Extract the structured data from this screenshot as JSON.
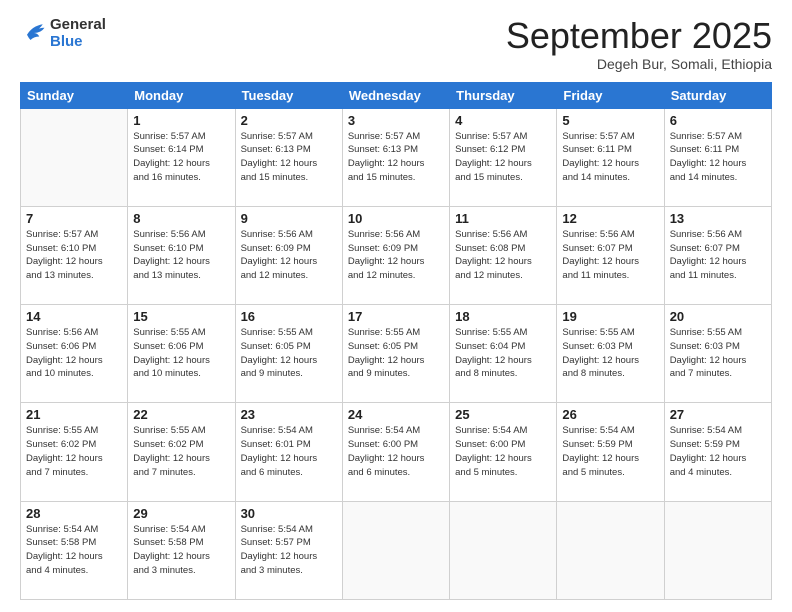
{
  "logo": {
    "line1": "General",
    "line2": "Blue"
  },
  "title": "September 2025",
  "subtitle": "Degeh Bur, Somali, Ethiopia",
  "days": [
    "Sunday",
    "Monday",
    "Tuesday",
    "Wednesday",
    "Thursday",
    "Friday",
    "Saturday"
  ],
  "weeks": [
    [
      {
        "num": "",
        "info": ""
      },
      {
        "num": "1",
        "info": "Sunrise: 5:57 AM\nSunset: 6:14 PM\nDaylight: 12 hours\nand 16 minutes."
      },
      {
        "num": "2",
        "info": "Sunrise: 5:57 AM\nSunset: 6:13 PM\nDaylight: 12 hours\nand 15 minutes."
      },
      {
        "num": "3",
        "info": "Sunrise: 5:57 AM\nSunset: 6:13 PM\nDaylight: 12 hours\nand 15 minutes."
      },
      {
        "num": "4",
        "info": "Sunrise: 5:57 AM\nSunset: 6:12 PM\nDaylight: 12 hours\nand 15 minutes."
      },
      {
        "num": "5",
        "info": "Sunrise: 5:57 AM\nSunset: 6:11 PM\nDaylight: 12 hours\nand 14 minutes."
      },
      {
        "num": "6",
        "info": "Sunrise: 5:57 AM\nSunset: 6:11 PM\nDaylight: 12 hours\nand 14 minutes."
      }
    ],
    [
      {
        "num": "7",
        "info": "Sunrise: 5:57 AM\nSunset: 6:10 PM\nDaylight: 12 hours\nand 13 minutes."
      },
      {
        "num": "8",
        "info": "Sunrise: 5:56 AM\nSunset: 6:10 PM\nDaylight: 12 hours\nand 13 minutes."
      },
      {
        "num": "9",
        "info": "Sunrise: 5:56 AM\nSunset: 6:09 PM\nDaylight: 12 hours\nand 12 minutes."
      },
      {
        "num": "10",
        "info": "Sunrise: 5:56 AM\nSunset: 6:09 PM\nDaylight: 12 hours\nand 12 minutes."
      },
      {
        "num": "11",
        "info": "Sunrise: 5:56 AM\nSunset: 6:08 PM\nDaylight: 12 hours\nand 12 minutes."
      },
      {
        "num": "12",
        "info": "Sunrise: 5:56 AM\nSunset: 6:07 PM\nDaylight: 12 hours\nand 11 minutes."
      },
      {
        "num": "13",
        "info": "Sunrise: 5:56 AM\nSunset: 6:07 PM\nDaylight: 12 hours\nand 11 minutes."
      }
    ],
    [
      {
        "num": "14",
        "info": "Sunrise: 5:56 AM\nSunset: 6:06 PM\nDaylight: 12 hours\nand 10 minutes."
      },
      {
        "num": "15",
        "info": "Sunrise: 5:55 AM\nSunset: 6:06 PM\nDaylight: 12 hours\nand 10 minutes."
      },
      {
        "num": "16",
        "info": "Sunrise: 5:55 AM\nSunset: 6:05 PM\nDaylight: 12 hours\nand 9 minutes."
      },
      {
        "num": "17",
        "info": "Sunrise: 5:55 AM\nSunset: 6:05 PM\nDaylight: 12 hours\nand 9 minutes."
      },
      {
        "num": "18",
        "info": "Sunrise: 5:55 AM\nSunset: 6:04 PM\nDaylight: 12 hours\nand 8 minutes."
      },
      {
        "num": "19",
        "info": "Sunrise: 5:55 AM\nSunset: 6:03 PM\nDaylight: 12 hours\nand 8 minutes."
      },
      {
        "num": "20",
        "info": "Sunrise: 5:55 AM\nSunset: 6:03 PM\nDaylight: 12 hours\nand 7 minutes."
      }
    ],
    [
      {
        "num": "21",
        "info": "Sunrise: 5:55 AM\nSunset: 6:02 PM\nDaylight: 12 hours\nand 7 minutes."
      },
      {
        "num": "22",
        "info": "Sunrise: 5:55 AM\nSunset: 6:02 PM\nDaylight: 12 hours\nand 7 minutes."
      },
      {
        "num": "23",
        "info": "Sunrise: 5:54 AM\nSunset: 6:01 PM\nDaylight: 12 hours\nand 6 minutes."
      },
      {
        "num": "24",
        "info": "Sunrise: 5:54 AM\nSunset: 6:00 PM\nDaylight: 12 hours\nand 6 minutes."
      },
      {
        "num": "25",
        "info": "Sunrise: 5:54 AM\nSunset: 6:00 PM\nDaylight: 12 hours\nand 5 minutes."
      },
      {
        "num": "26",
        "info": "Sunrise: 5:54 AM\nSunset: 5:59 PM\nDaylight: 12 hours\nand 5 minutes."
      },
      {
        "num": "27",
        "info": "Sunrise: 5:54 AM\nSunset: 5:59 PM\nDaylight: 12 hours\nand 4 minutes."
      }
    ],
    [
      {
        "num": "28",
        "info": "Sunrise: 5:54 AM\nSunset: 5:58 PM\nDaylight: 12 hours\nand 4 minutes."
      },
      {
        "num": "29",
        "info": "Sunrise: 5:54 AM\nSunset: 5:58 PM\nDaylight: 12 hours\nand 3 minutes."
      },
      {
        "num": "30",
        "info": "Sunrise: 5:54 AM\nSunset: 5:57 PM\nDaylight: 12 hours\nand 3 minutes."
      },
      {
        "num": "",
        "info": ""
      },
      {
        "num": "",
        "info": ""
      },
      {
        "num": "",
        "info": ""
      },
      {
        "num": "",
        "info": ""
      }
    ]
  ]
}
